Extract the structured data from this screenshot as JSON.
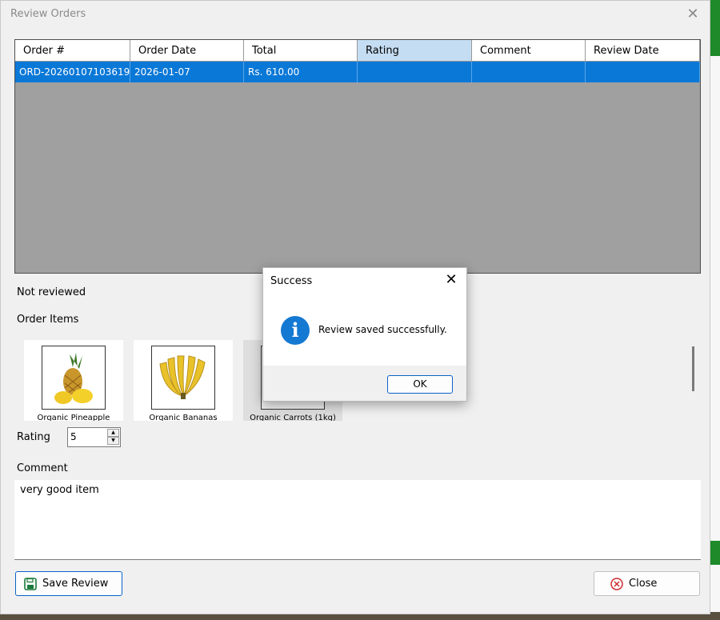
{
  "window": {
    "title": "Review Orders"
  },
  "grid": {
    "columns": [
      "Order #",
      "Order Date",
      "Total",
      "Rating",
      "Comment",
      "Review Date"
    ],
    "selected_column": 3,
    "rows": [
      {
        "order_no": "ORD-20260107103619",
        "order_date": "2026-01-07",
        "total": "Rs. 610.00",
        "rating": "",
        "comment": "",
        "review_date": ""
      }
    ]
  },
  "status_text": "Not reviewed",
  "order_items": {
    "label": "Order Items",
    "items": [
      {
        "name": "Organic Pineapple",
        "icon": "pineapple-image"
      },
      {
        "name": "Organic Bananas",
        "icon": "bananas-image"
      },
      {
        "name": "Organic Carrots (1kg)",
        "icon": "carrots-image"
      }
    ]
  },
  "rating": {
    "label": "Rating",
    "value": "5"
  },
  "comment": {
    "label": "Comment",
    "value": "very good item"
  },
  "buttons": {
    "save": "Save Review",
    "close": "Close"
  },
  "dialog": {
    "title": "Success",
    "message": "Review saved successfully.",
    "ok": "OK",
    "icon": "info-icon"
  },
  "colors": {
    "selection": "#0a78d7",
    "accent_border": "#0a63c8",
    "info": "#1479d2"
  }
}
